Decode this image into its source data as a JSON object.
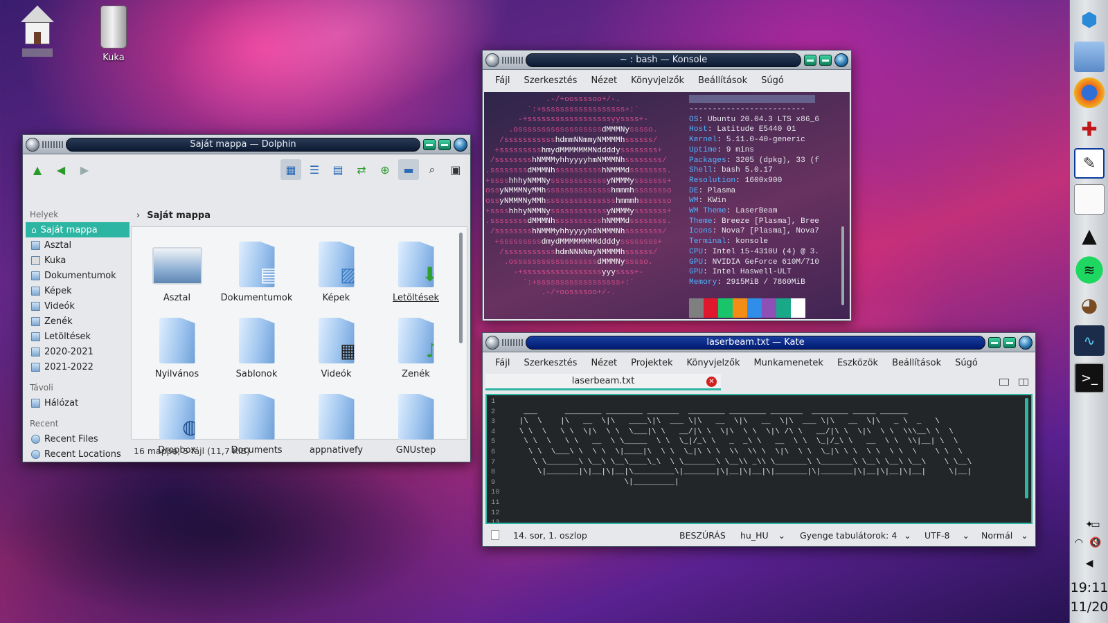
{
  "desktop": {
    "icons": [
      {
        "name": "home-folder",
        "label": ""
      },
      {
        "name": "trash",
        "label": "Kuka"
      }
    ]
  },
  "dolphin": {
    "title": "Saját mappa — Dolphin",
    "places_header": "Helyek",
    "places": [
      "Saját mappa",
      "Asztal",
      "Kuka",
      "Dokumentumok",
      "Képek",
      "Videók",
      "Zenék",
      "Letöltések",
      "2020-2021",
      "2021-2022"
    ],
    "remote_header": "Távoli",
    "remote": [
      "Hálózat"
    ],
    "recent_header": "Recent",
    "recent": [
      "Recent Files",
      "Recent Locations"
    ],
    "breadcrumb": "Saját mappa",
    "items": [
      "Asztal",
      "Dokumentumok",
      "Képek",
      "Letöltések",
      "Nyilvános",
      "Sablonok",
      "Videók",
      "Zenék",
      "Dropbox",
      "Documents",
      "appnativefy",
      "GNUstep"
    ],
    "status": "16 mappa, 5 fájl (11,7 KiB)"
  },
  "konsole": {
    "title": "~ : bash — Konsole",
    "menu": [
      "Fájl",
      "Szerkesztés",
      "Nézet",
      "Könyvjelzők",
      "Beállítások",
      "Súgó"
    ],
    "separator": "-------------------------",
    "info": [
      {
        "k": "OS",
        "v": " Ubuntu 20.04.3 LTS x86_6"
      },
      {
        "k": "Host",
        "v": " Latitude E5440 01"
      },
      {
        "k": "Kernel",
        "v": " 5.11.0-40-generic"
      },
      {
        "k": "Uptime",
        "v": " 9 mins"
      },
      {
        "k": "Packages",
        "v": " 3205 (dpkg), 33 (f"
      },
      {
        "k": "Shell",
        "v": " bash 5.0.17"
      },
      {
        "k": "Resolution",
        "v": " 1600x900"
      },
      {
        "k": "DE",
        "v": " Plasma"
      },
      {
        "k": "WM",
        "v": " KWin"
      },
      {
        "k": "WM Theme",
        "v": " LaserBeam"
      },
      {
        "k": "Theme",
        "v": " Breeze [Plasma], Bree"
      },
      {
        "k": "Icons",
        "v": " Nova7 [Plasma], Nova7"
      },
      {
        "k": "Terminal",
        "v": " konsole"
      },
      {
        "k": "CPU",
        "v": " Intel i5-4310U (4) @ 3."
      },
      {
        "k": "GPU",
        "v": " NVIDIA GeForce 610M/710"
      },
      {
        "k": "GPU",
        "v": " Intel Haswell-ULT"
      },
      {
        "k": "Memory",
        "v": " 2915MiB / 7860MiB"
      }
    ],
    "swatches": [
      "#7f7f7f",
      "#e0182e",
      "#19c46a",
      "#f38d16",
      "#2f8ee8",
      "#8e4fb6",
      "#19a888",
      "#ffffff"
    ]
  },
  "kate": {
    "title": "laserbeam.txt — Kate",
    "menu": [
      "Fájl",
      "Szerkesztés",
      "Nézet",
      "Projektek",
      "Könyvjelzők",
      "Munkamenetek",
      "Eszközök",
      "Beállítások",
      "Súgó"
    ],
    "tab": "laserbeam.txt",
    "status": {
      "position": "14. sor, 1. oszlop",
      "mode": "BESZÚRÁS",
      "lang": "hu_HU",
      "indent": "Gyenge tabulátorok: 4",
      "encoding": "UTF-8",
      "highlight": "Normál"
    }
  },
  "panel": {
    "time": "19:11",
    "date": "11/20"
  }
}
